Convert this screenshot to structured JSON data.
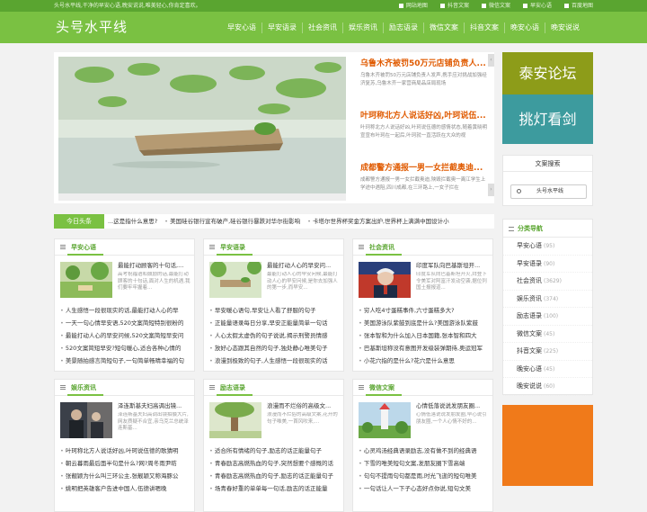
{
  "topbar": {
    "tagline": "头号水平线,干净的早安心语,晚安说说,唯美轻心,你肯定喜欢。",
    "links": [
      "网站地图",
      "抖音文案",
      "微信文案",
      "早安心语",
      "百度地图"
    ]
  },
  "header": {
    "logo": "头号水平线",
    "nav": [
      "早安心语",
      "早安语录",
      "社会资讯",
      "娱乐资讯",
      "励志语录",
      "微信文案",
      "抖音文案",
      "晚安心语",
      "晚安说说"
    ]
  },
  "slider": {
    "items": [
      {
        "title": "乌鲁木齐被罚50万元店铺负责人...",
        "desc": "乌鲁木齐被罚50万元店铺负责人发声,携手应对挑战加强经济复苏,乌鲁木齐一家营商局品店局现场"
      },
      {
        "title": "叶珂称北方人说话好凶,叶珂说伍...",
        "desc": "叶珂称北方人说话好凶,叶珂说伍德的感情状态,随着黄晓明宣宣布叶珂在一起后,叶珂就一直活跃在大众的视"
      },
      {
        "title": "成都警方通报一男一女拦截奥迪...",
        "desc": "成都警方通报一男一女拦截奥迪,殃毁拦截奥一离江学生上学途中遇阻,四川成都,在三环路上,一女子拦在"
      }
    ]
  },
  "ticker": {
    "label": "今日头条",
    "items": [
      "...这是指什么意思?",
      "美国硅谷银行宣布破产,硅谷银行暴跌对华尔街影响",
      "卡塔尔世界杯奖金方案出炉,世界杯上满满中国设计小"
    ]
  },
  "cards": [
    {
      "title": "早安心语",
      "feat_title": "最能打动顾客的十句话,...",
      "feat_desc": "高考祝福语和鼓励的话,最能打动顾客的十句话,面对人生的机遇,我们要牢牢握着...",
      "list": [
        "人生感悟一段很现实的话,最能打动人心的早",
        "一天一句心情早安语,520文案简短特别很粉的",
        "最能打动人心的早安问候,520文案简短早安问",
        "520文案简短早安?短句暖心,适合各种心情的",
        "美景随拍感言简短句子,一句简单畅晴幸福的句"
      ]
    },
    {
      "title": "早安语录",
      "feat_title": "最能打动人心的早安问...",
      "feat_desc": "最能打动人心的早安问候,最能打动人心的早安问候,是你去加强人的第一步,而早安...",
      "list": [
        "早安暖心语句,早安让人看了舒服的句子",
        "正能量语录每日分享,早安正能量简单一句话",
        "人心太假太虚伪的句子说说,揭示刑警员情感",
        "放好心态跟其自然的句子,独处静心唯美句子",
        "浪漫到极致的句子,人生感悟一段很现实的话"
      ]
    },
    {
      "title": "社会资讯",
      "feat_title": "印度军队向巴基斯坦开...",
      "feat_desc": "印度军队向巴基斯坦开火,拜登下令美军对阿富汗发动空袭,据位列国土报报道...",
      "list": [
        "穷人吃4寸蛋糕事件,六寸蛋糕多大?",
        "美国游泳队紫鼓到底是什么?美国游泳队紫鼓",
        "张本智和为什么加入日本国籍,张本智和四大",
        "巴基斯坦称没有意图开发级装弹期待,奥运冠军",
        "小花穴指的是什么?花穴是什么意思"
      ]
    },
    {
      "title": "娱乐资讯",
      "feat_title": "泽连斯基夫妇高调出镜...",
      "feat_desc": "泽连斯基夫妇高调出镜拍摄大片,网友质疑不合宜,亲乌克兰总统泽连斯基...",
      "list": [
        "叶珂称北方人说话好凶,叶珂说伍德的歌猜明",
        "朝云暮雨最后面半句是什么?网?周冬雨尹昉",
        "张靓颖为什么叫三环公主,张靓颖又称海豚公",
        "姚明把英雄客户告进中国人,伍德讲嗯晚"
      ]
    },
    {
      "title": "励志语录",
      "feat_title": "浪漫而不烂俗的高级文...",
      "feat_desc": "浪漫而不烂俗的高级文案,花开的句子唯美,一首风吹来,...",
      "list": [
        "适合所有情绪的句子,励志的话正能量句子",
        "青春励志高燃热血的句子,突然想要个感慨的话",
        "青春励志高燃热血的句子,励志的话正能量句子",
        "场青春好重的单单每一句话,励志的话正能量"
      ]
    },
    {
      "title": "微信文案",
      "feat_title": "心情低落说说发朋友圈...",
      "feat_desc": "心情低落说说发朋友圈,早心说引朋友圈,一个人心情不好的...",
      "list": [
        "心灵鸡汤经典语录励志,没有做不到的经典语",
        "下雪的唯美短句文案,发朋友圈下雪高端",
        "句句不提雨句句都是雨,时光飞逝的短句唯美",
        "一句话让人一下子心态好点你说,短句文美"
      ]
    }
  ],
  "right": {
    "banner1": "泰安论坛",
    "banner2": "挑灯看剑",
    "search_title": "文案搜索",
    "search_placeholder": "头号水平线",
    "cat_title": "分类导航",
    "categories": [
      {
        "name": "早安心语",
        "count": "(95)"
      },
      {
        "name": "早安语录",
        "count": "(90)"
      },
      {
        "name": "社会资讯",
        "count": "(3629)"
      },
      {
        "name": "娱乐资讯",
        "count": "(374)"
      },
      {
        "name": "励志语录",
        "count": "(100)"
      },
      {
        "name": "微信文案",
        "count": "(45)"
      },
      {
        "name": "抖音文案",
        "count": "(225)"
      },
      {
        "name": "晚安心语",
        "count": "(45)"
      },
      {
        "name": "晚安说说",
        "count": "(60)"
      }
    ]
  }
}
